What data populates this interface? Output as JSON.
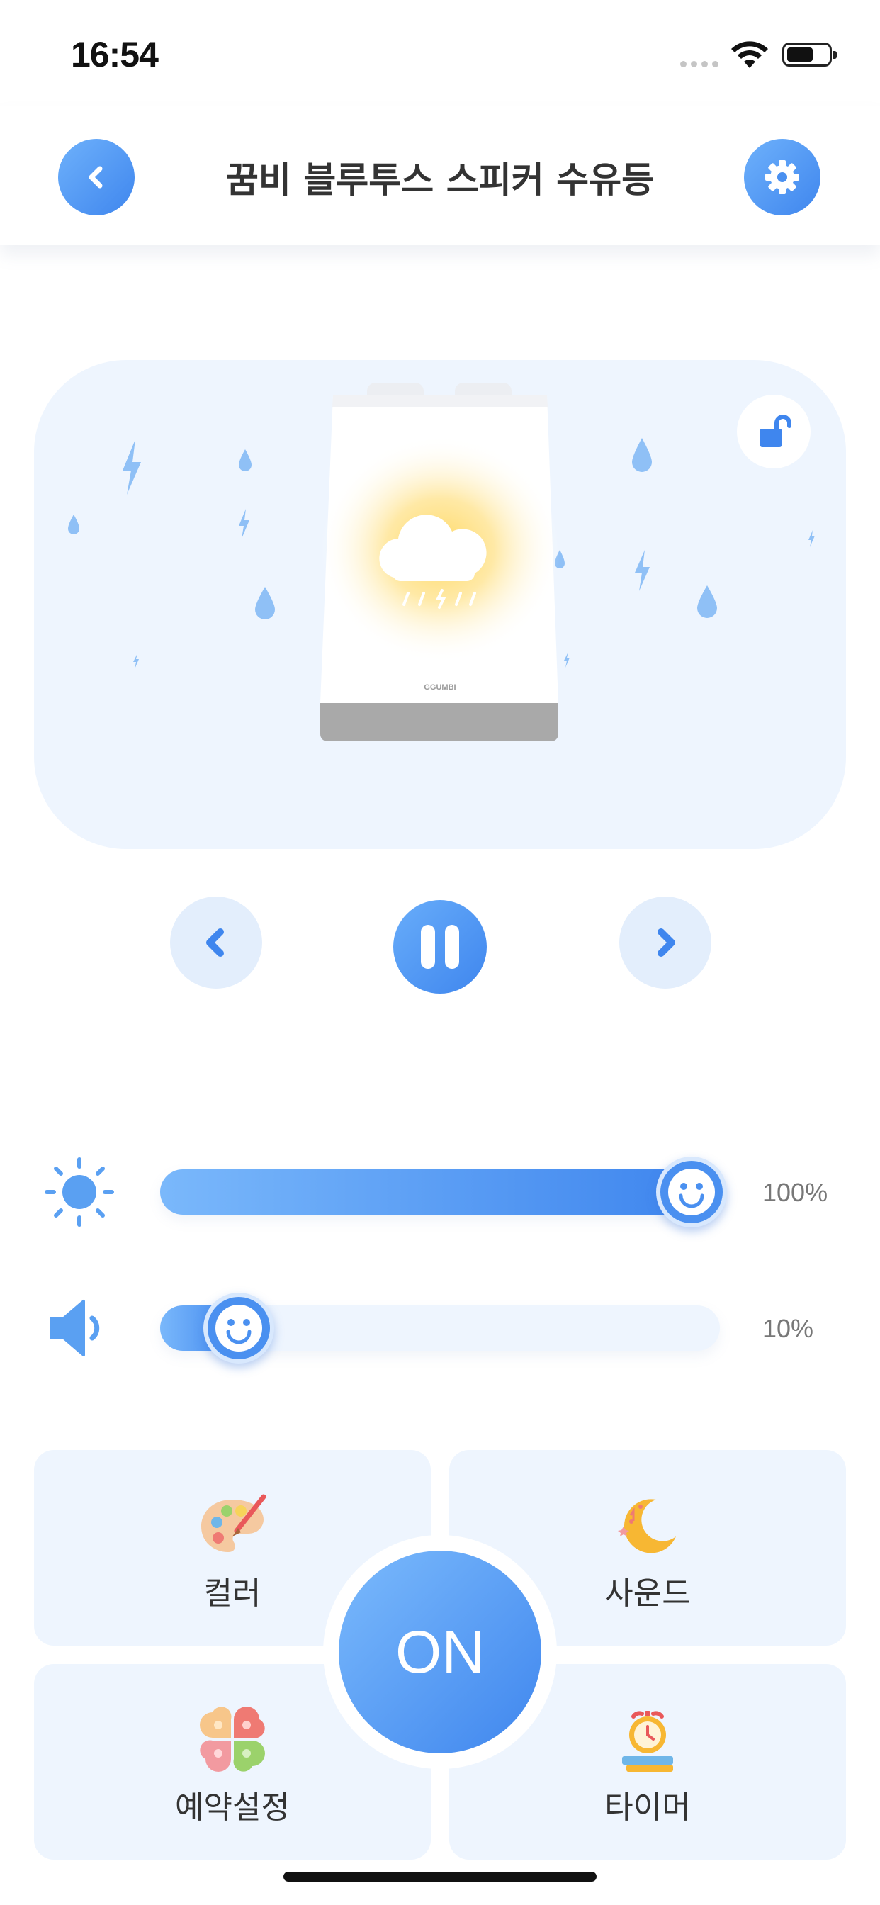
{
  "status_bar": {
    "time": "16:54"
  },
  "header": {
    "title": "꿈비 블루투스 스피커 수유등"
  },
  "device": {
    "brand_label": "GGUMBI",
    "locked": false
  },
  "brightness": {
    "value_label": "100%",
    "level": 1.0
  },
  "volume": {
    "value_label": "10%",
    "level": 0.1
  },
  "menu": {
    "color": "컬러",
    "sound": "사운드",
    "schedule": "예약설정",
    "timer": "타이머"
  },
  "power": {
    "label": "ON"
  },
  "colors": {
    "accent": "#3f86ee",
    "accent_light": "#7bbafc",
    "card_bg": "#eef5fe"
  }
}
